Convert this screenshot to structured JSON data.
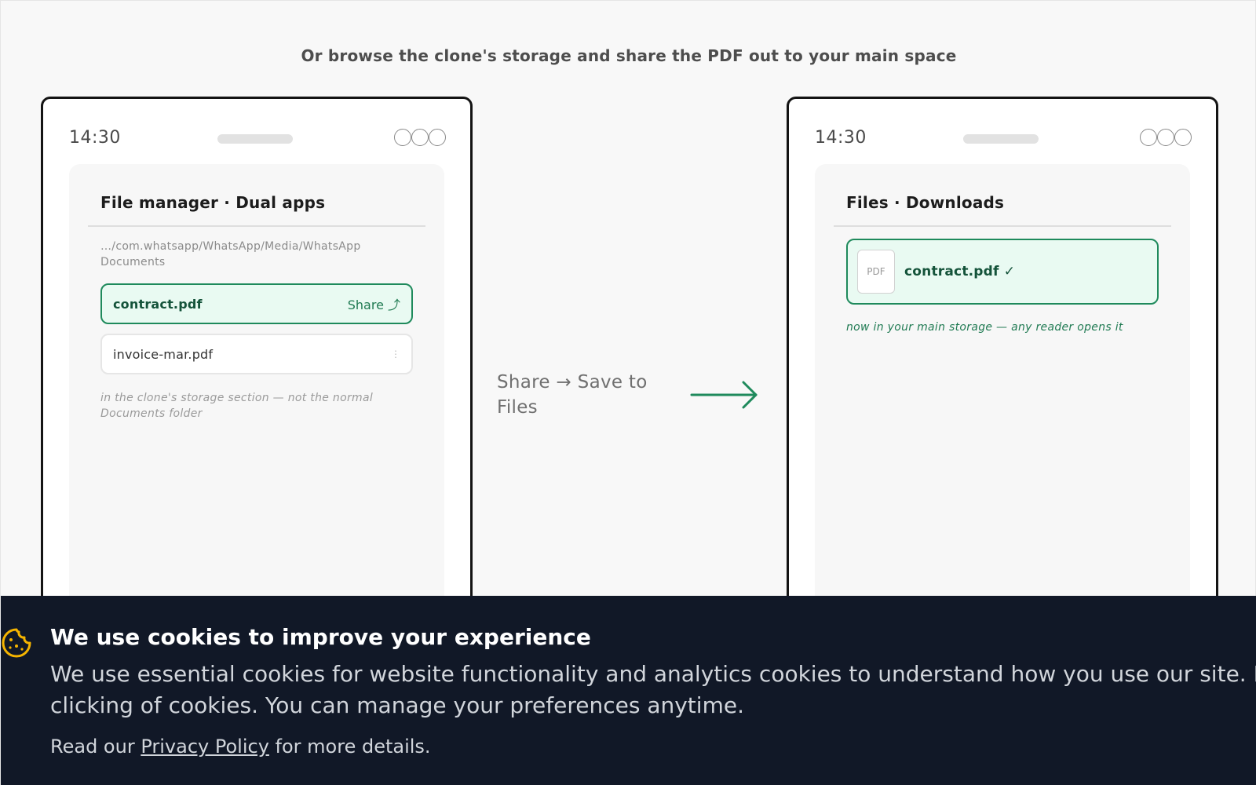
{
  "heading": "Or browse the clone's storage and share the PDF out to your main space",
  "left_phone": {
    "time": "14:30",
    "title": "File manager · Dual apps",
    "path": "…/com.whatsapp/WhatsApp/Media/WhatsApp Documents",
    "files": [
      {
        "name": "contract.pdf",
        "action": "Share ⤴"
      },
      {
        "name": "invoice-mar.pdf",
        "action": "⋮"
      }
    ],
    "note": "in the clone's storage section — not the normal Documents folder"
  },
  "middle": {
    "label": "Share → Save to Files"
  },
  "right_phone": {
    "time": "14:30",
    "title": "Files · Downloads",
    "pdf_badge": "PDF",
    "file_name": "contract.pdf ✓",
    "note": "now in your main storage — any reader opens it"
  },
  "cookie_banner": {
    "title": "We use cookies to improve your experience",
    "body": "We use essential cookies for website functionality and analytics cookies to understand how you use our site. By clicking of cookies. You can manage your preferences anytime.",
    "read_prefix": "Read our",
    "privacy_link": "Privacy Policy",
    "read_suffix": "for more details.",
    "icon": "cookie-icon"
  },
  "colors": {
    "accent": "#1f8a5c",
    "accent_bg": "#e9faf2",
    "banner_bg": "#111827",
    "cookie_icon": "#f5b400"
  }
}
